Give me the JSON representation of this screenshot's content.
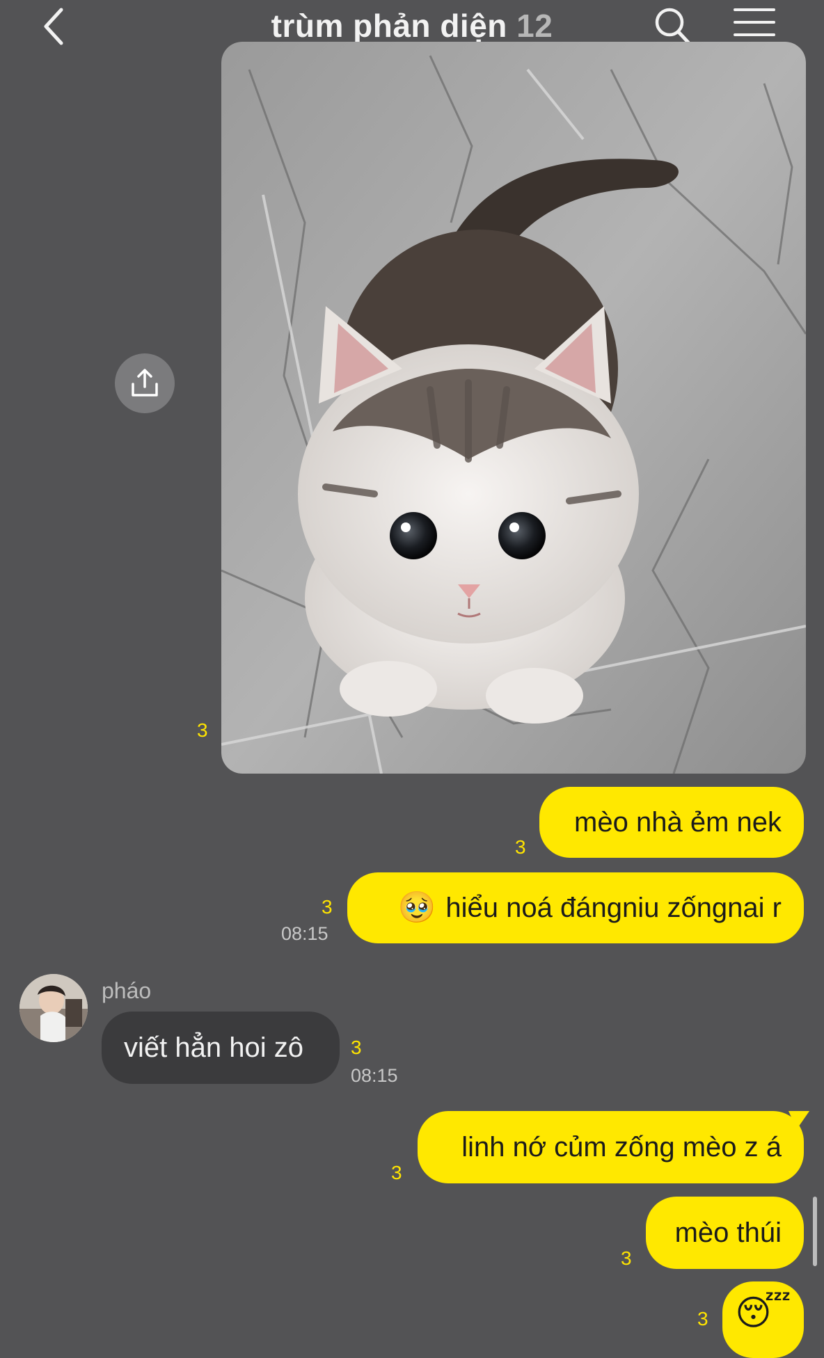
{
  "header": {
    "title": "trùm phản diện",
    "member_count": "12",
    "back_icon": "chevron-left-icon",
    "search_icon": "search-icon",
    "menu_icon": "hamburger-menu-icon"
  },
  "photo_message": {
    "unread": "3",
    "share_icon": "share-upload-icon"
  },
  "messages": [
    {
      "side": "mine",
      "text": "mèo nhà ẻm nek",
      "unread": "3"
    },
    {
      "side": "mine",
      "emoji": "🥹",
      "text": "hiểu noá đángniu zốngnai r",
      "unread": "3",
      "time": "08:15"
    },
    {
      "side": "theirs",
      "sender": "pháo",
      "text": "viết hẳn hoi zô",
      "unread": "3",
      "time": "08:15"
    },
    {
      "side": "mine",
      "text": "linh nớ củm zống mèo z á",
      "unread": "3"
    },
    {
      "side": "mine",
      "text": "mèo thúi",
      "unread": "3"
    },
    {
      "side": "mine",
      "emoji": "😴",
      "text": "",
      "unread": "3"
    }
  ],
  "colors": {
    "background": "#535355",
    "my_bubble": "#ffe800",
    "their_bubble": "#3b3b3d",
    "unread": "#ffe400"
  }
}
